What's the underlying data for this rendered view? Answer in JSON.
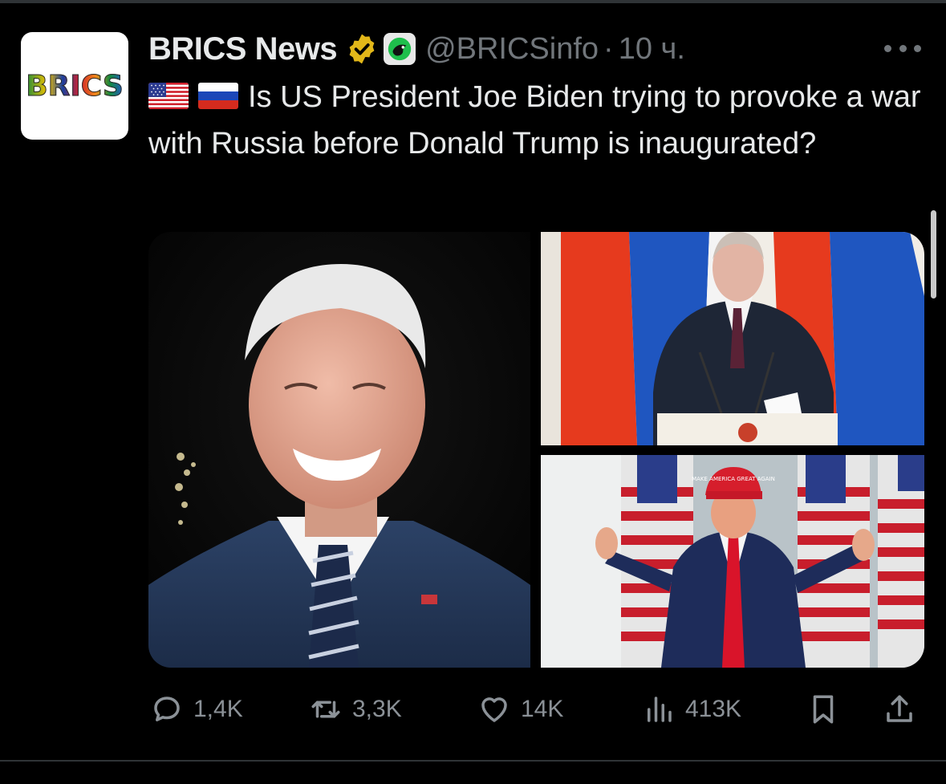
{
  "author": {
    "avatar_text": "BRICS",
    "name": "BRICS News",
    "handle": "@BRICSinfo",
    "separator": "·",
    "time": "10 ч."
  },
  "tweet": {
    "flags": [
      "us-flag-icon",
      "russia-flag-icon"
    ],
    "text": "Is US President Joe Biden trying to provoke a war with Russia before Donald Trump is inaugurated?"
  },
  "media": {
    "images": [
      "joe-biden-photo",
      "vladimir-putin-photo",
      "donald-trump-photo"
    ],
    "hat_text": "MAKE AMERICA GREAT AGAIN"
  },
  "actions": {
    "replies": "1,4K",
    "reposts": "3,3K",
    "likes": "14K",
    "views": "413K"
  },
  "colors": {
    "background": "#000000",
    "text": "#e7e9ea",
    "muted": "#71767b",
    "verified_gold": "#e2b719"
  }
}
